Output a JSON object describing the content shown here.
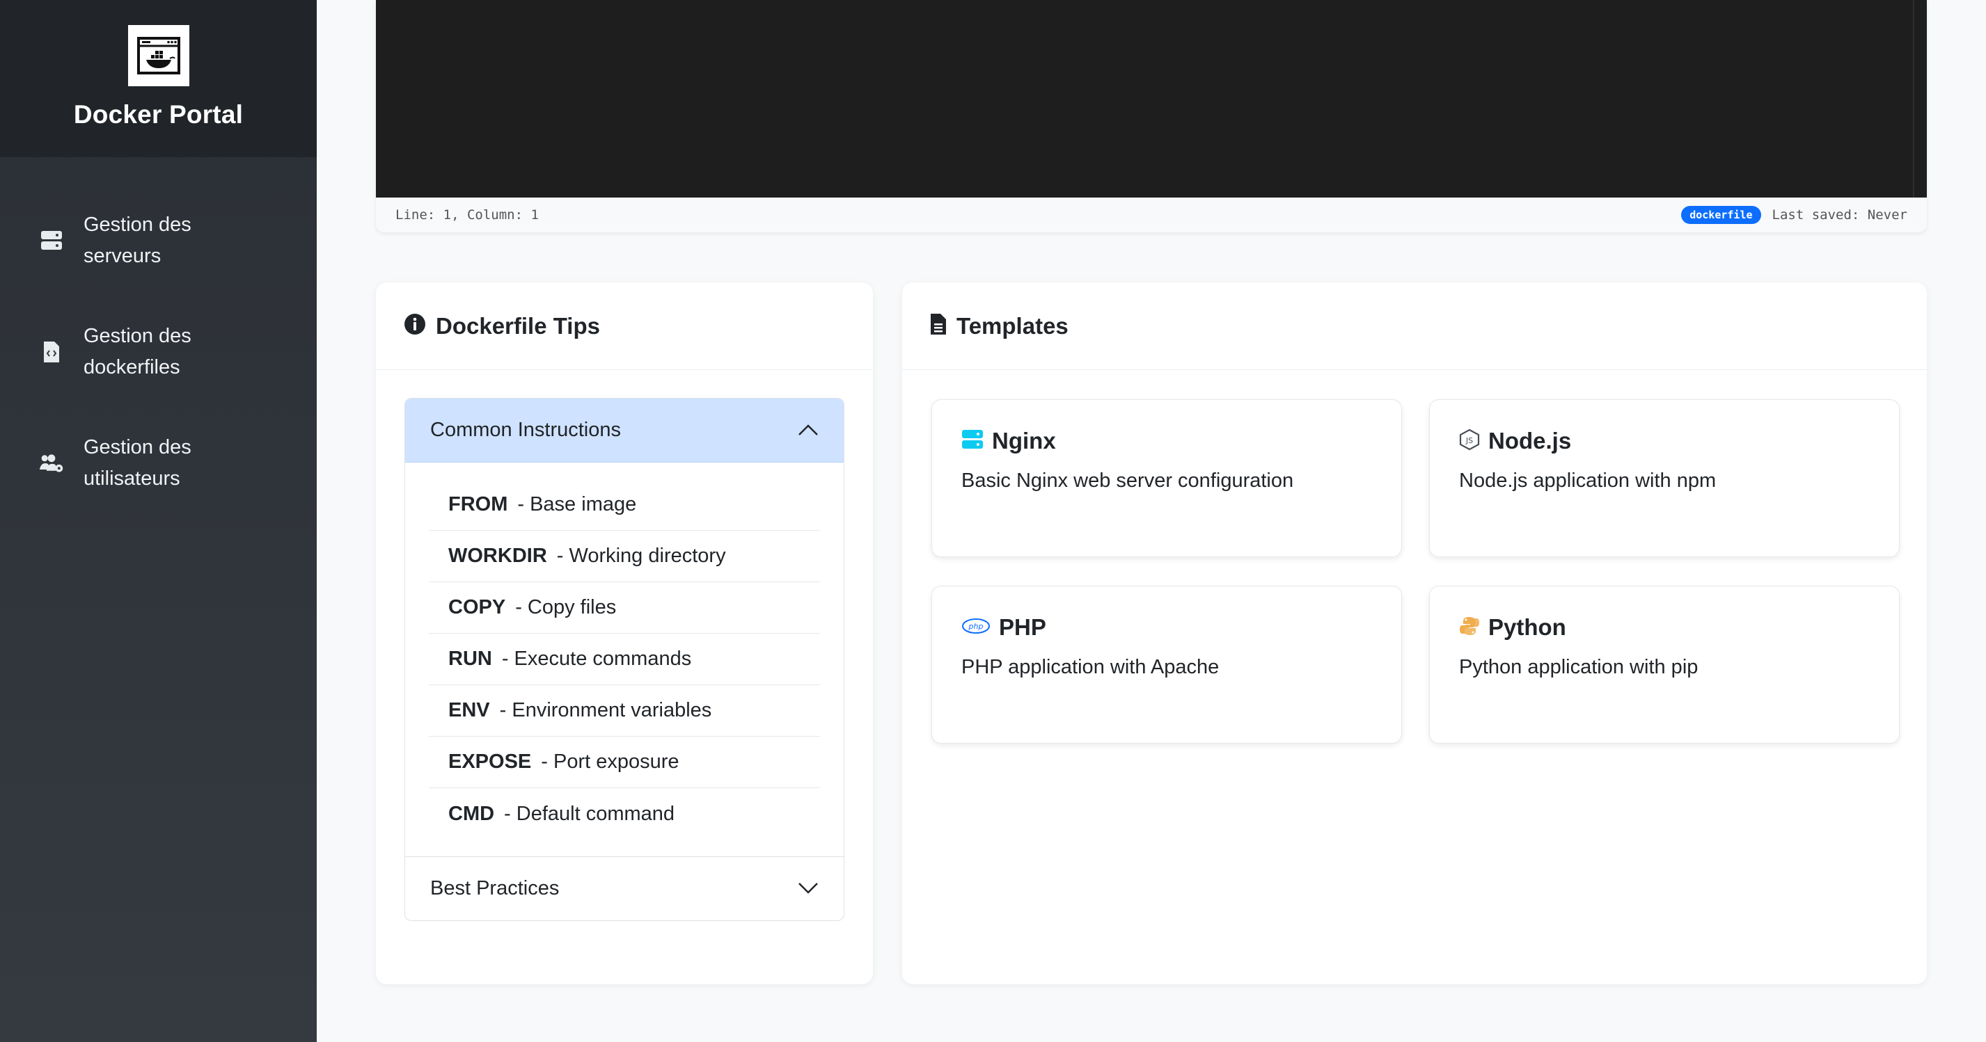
{
  "app": {
    "title": "Docker Portal"
  },
  "sidebar": {
    "items": [
      {
        "label": "Gestion des serveurs",
        "icon": "server-icon"
      },
      {
        "label": "Gestion des dockerfiles",
        "icon": "file-code-icon"
      },
      {
        "label": "Gestion des utilisateurs",
        "icon": "users-cog-icon"
      }
    ]
  },
  "editor": {
    "cursor": "Line: 1, Column: 1",
    "language": "dockerfile",
    "last_saved": "Last saved: Never"
  },
  "tips": {
    "title": "Dockerfile Tips",
    "sections": [
      {
        "title": "Common Instructions",
        "expanded": true,
        "items": [
          {
            "keyword": "FROM",
            "desc": "- Base image"
          },
          {
            "keyword": "WORKDIR",
            "desc": "- Working directory"
          },
          {
            "keyword": "COPY",
            "desc": "- Copy files"
          },
          {
            "keyword": "RUN",
            "desc": "- Execute commands"
          },
          {
            "keyword": "ENV",
            "desc": "- Environment variables"
          },
          {
            "keyword": "EXPOSE",
            "desc": "- Port exposure"
          },
          {
            "keyword": "CMD",
            "desc": "- Default command"
          }
        ]
      },
      {
        "title": "Best Practices",
        "expanded": false
      }
    ]
  },
  "templates": {
    "title": "Templates",
    "items": [
      {
        "name": "Nginx",
        "desc": "Basic Nginx web server configuration",
        "icon": "server-icon",
        "color": "#0dcaf0"
      },
      {
        "name": "Node.js",
        "desc": "Node.js application with npm",
        "icon": "nodejs-icon",
        "color": "#495057"
      },
      {
        "name": "PHP",
        "desc": "PHP application with Apache",
        "icon": "php-icon",
        "color": "#0d6efd"
      },
      {
        "name": "Python",
        "desc": "Python application with pip",
        "icon": "python-icon",
        "color": "#f0ad4e"
      }
    ]
  },
  "colors": {
    "sidebar_bg": "#343a40",
    "brand_bg": "#212529",
    "accent": "#0d6efd",
    "accordion_open": "#cfe2ff",
    "editor_bg": "#1e1e1e"
  }
}
